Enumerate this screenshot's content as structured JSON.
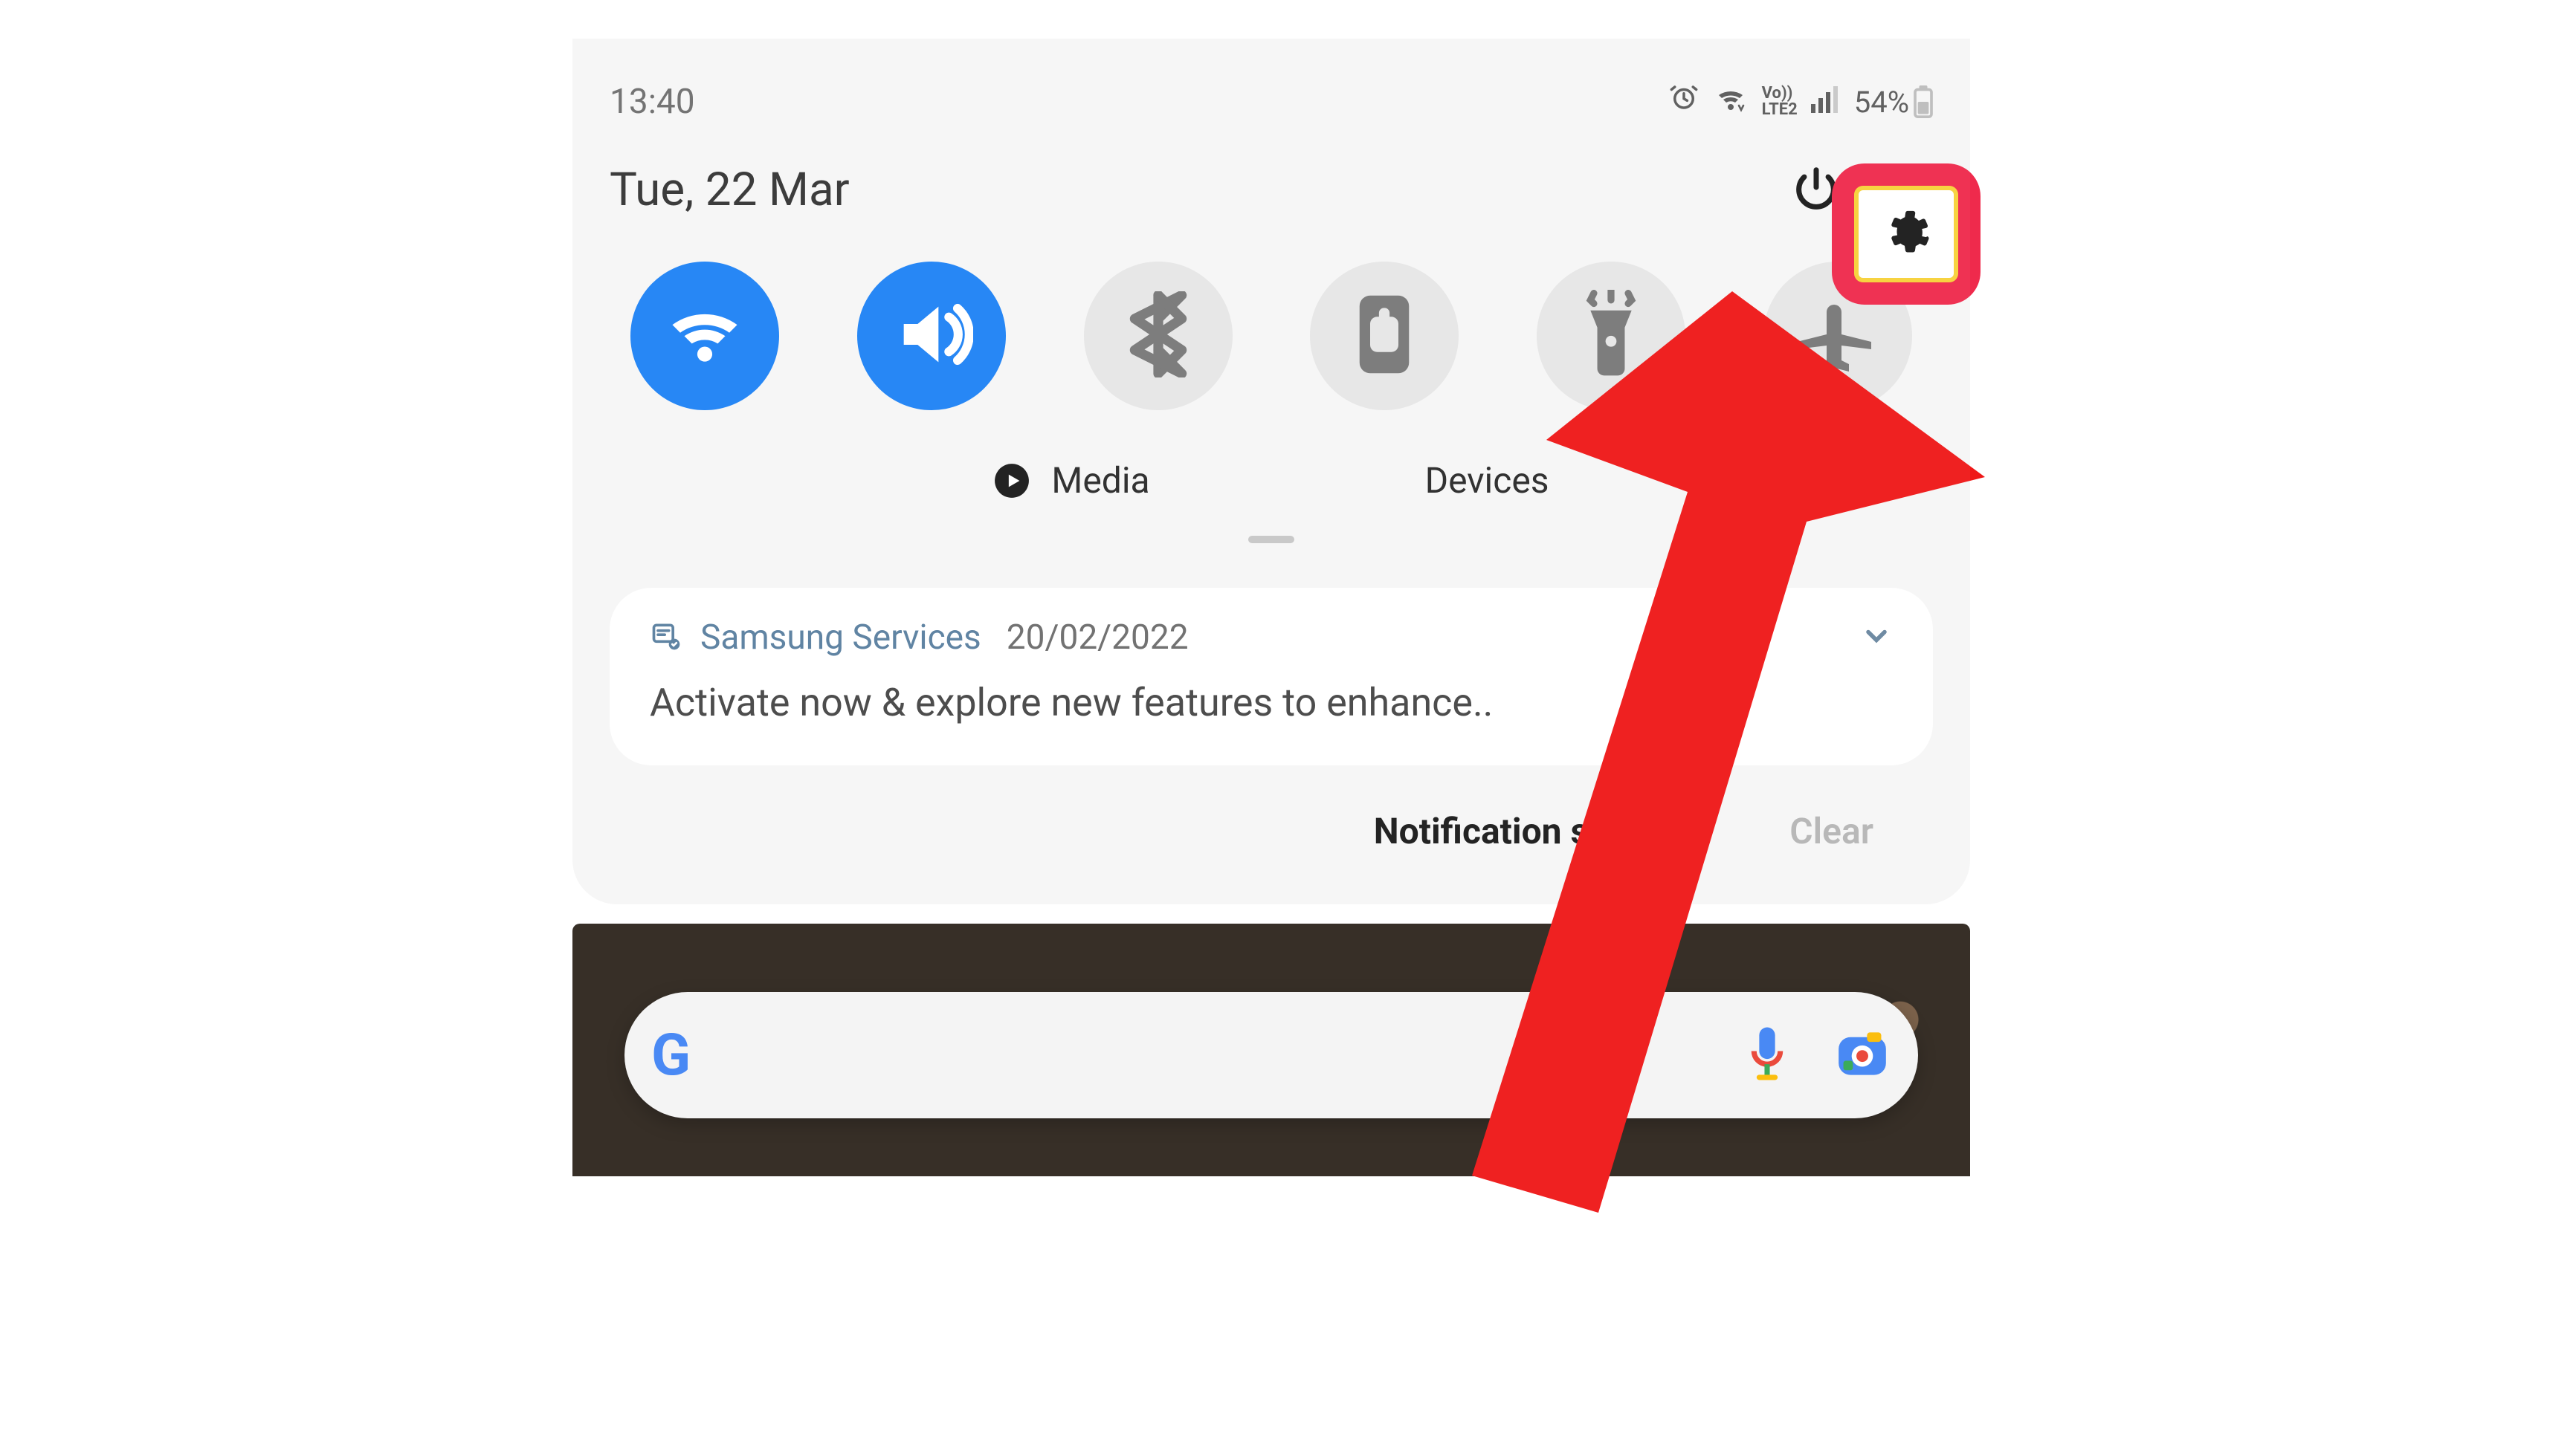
{
  "status": {
    "time": "13:40",
    "volte_top": "Vo))",
    "volte_bottom": "LTE2",
    "battery": "54%"
  },
  "header": {
    "date": "Tue, 22 Mar"
  },
  "toggles": {
    "wifi": {
      "on": true
    },
    "sound": {
      "on": true
    },
    "bluetooth": {
      "on": false
    },
    "rotation": {
      "on": false
    },
    "flashlight": {
      "on": false
    },
    "airplane": {
      "on": false
    }
  },
  "row2": {
    "media": "Media",
    "devices": "Devices"
  },
  "notif": {
    "app": "Samsung Services",
    "date": "20/02/2022",
    "body": "Activate now & explore new features to enhance.."
  },
  "actions": {
    "settings": "Notification settings",
    "clear": "Clear"
  },
  "annotation": {
    "target": "settings-button",
    "color": "#ef1818",
    "highlight_color": "#ef2a4c"
  }
}
